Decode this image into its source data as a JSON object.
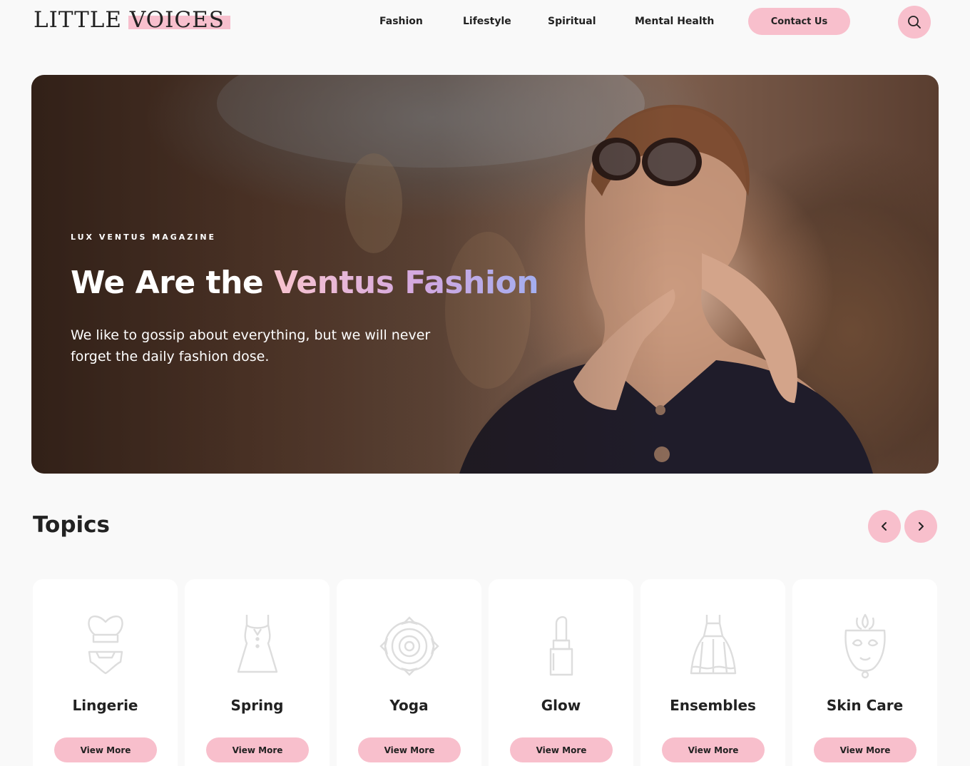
{
  "header": {
    "logo_word1": "LITTLE",
    "logo_word2": "VOICES",
    "nav": [
      "Fashion",
      "Lifestyle",
      "Spiritual",
      "Mental Health"
    ],
    "contact_label": "Contact Us",
    "search_icon": "search-icon"
  },
  "hero": {
    "kicker": "LUX VENTUS MAGAZINE",
    "title_plain": "We Are the",
    "title_accent": "Ventus Fashion",
    "subtitle": "We like to gossip about everything, but we will never forget the daily fashion dose."
  },
  "topics": {
    "title": "Topics",
    "prev_icon": "chevron-left-icon",
    "next_icon": "chevron-right-icon",
    "view_label": "View More",
    "items": [
      {
        "name": "Lingerie",
        "icon": "lingerie-icon"
      },
      {
        "name": "Spring",
        "icon": "dress-icon"
      },
      {
        "name": "Yoga",
        "icon": "chakra-icon"
      },
      {
        "name": "Glow",
        "icon": "lipstick-icon"
      },
      {
        "name": "Ensembles",
        "icon": "gown-icon"
      },
      {
        "name": "Skin Care",
        "icon": "face-mask-icon"
      }
    ]
  },
  "colors": {
    "accent": "#f8bfcc",
    "background": "#f9f9f9",
    "text": "#222222"
  }
}
